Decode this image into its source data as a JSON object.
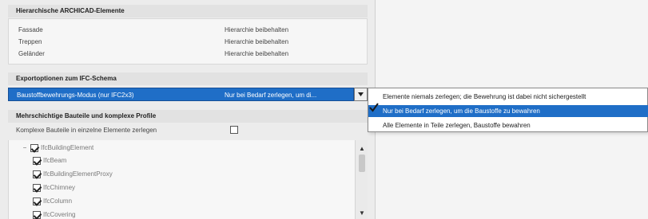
{
  "hierarchy": {
    "title": "Hierarchische ARCHICAD-Elemente",
    "rows": [
      {
        "name": "Fassade",
        "value": "Hierarchie beibehalten"
      },
      {
        "name": "Treppen",
        "value": "Hierarchie beibehalten"
      },
      {
        "name": "Geländer",
        "value": "Hierarchie beibehalten"
      }
    ]
  },
  "export": {
    "title": "Exportoptionen zum IFC-Schema",
    "selected_label": "Baustoffbewehrungs-Modus (nur IFC2x3)",
    "selected_value": "Nur bei Bedarf zerlegen, um di..."
  },
  "multilayer": {
    "title": "Mehrschichtige Bauteile und komplexe Profile",
    "option_label": "Komplexe Bauteile in einzelne Elemente zerlegen",
    "option_checked": false
  },
  "tree": {
    "items": [
      {
        "label": "IfcBuildingElement",
        "checked": true,
        "toggle": "−"
      },
      {
        "label": "IfcBeam",
        "checked": true
      },
      {
        "label": "IfcBuildingElementProxy",
        "checked": true
      },
      {
        "label": "IfcChimney",
        "checked": true
      },
      {
        "label": "IfcColumn",
        "checked": true
      },
      {
        "label": "IfcCovering",
        "checked": true
      }
    ]
  },
  "dropdown": {
    "options": [
      "Elemente niemals zerlegen; die Bewehrung ist dabei nicht sichergestellt",
      "Nur bei Bedarf zerlegen, um die Baustoffe zu bewahren",
      "Alle Elemente in Teile zerlegen, Baustoffe bewahren"
    ],
    "selected_index": 1
  },
  "colors": {
    "selection": "#1f6ec7",
    "panel_bg": "#ececec"
  },
  "icons": {
    "dropdown": "chevron-down-icon",
    "check": "checkmark-icon",
    "scroll_up": "arrow-up-icon",
    "scroll_down": "arrow-down-icon"
  }
}
